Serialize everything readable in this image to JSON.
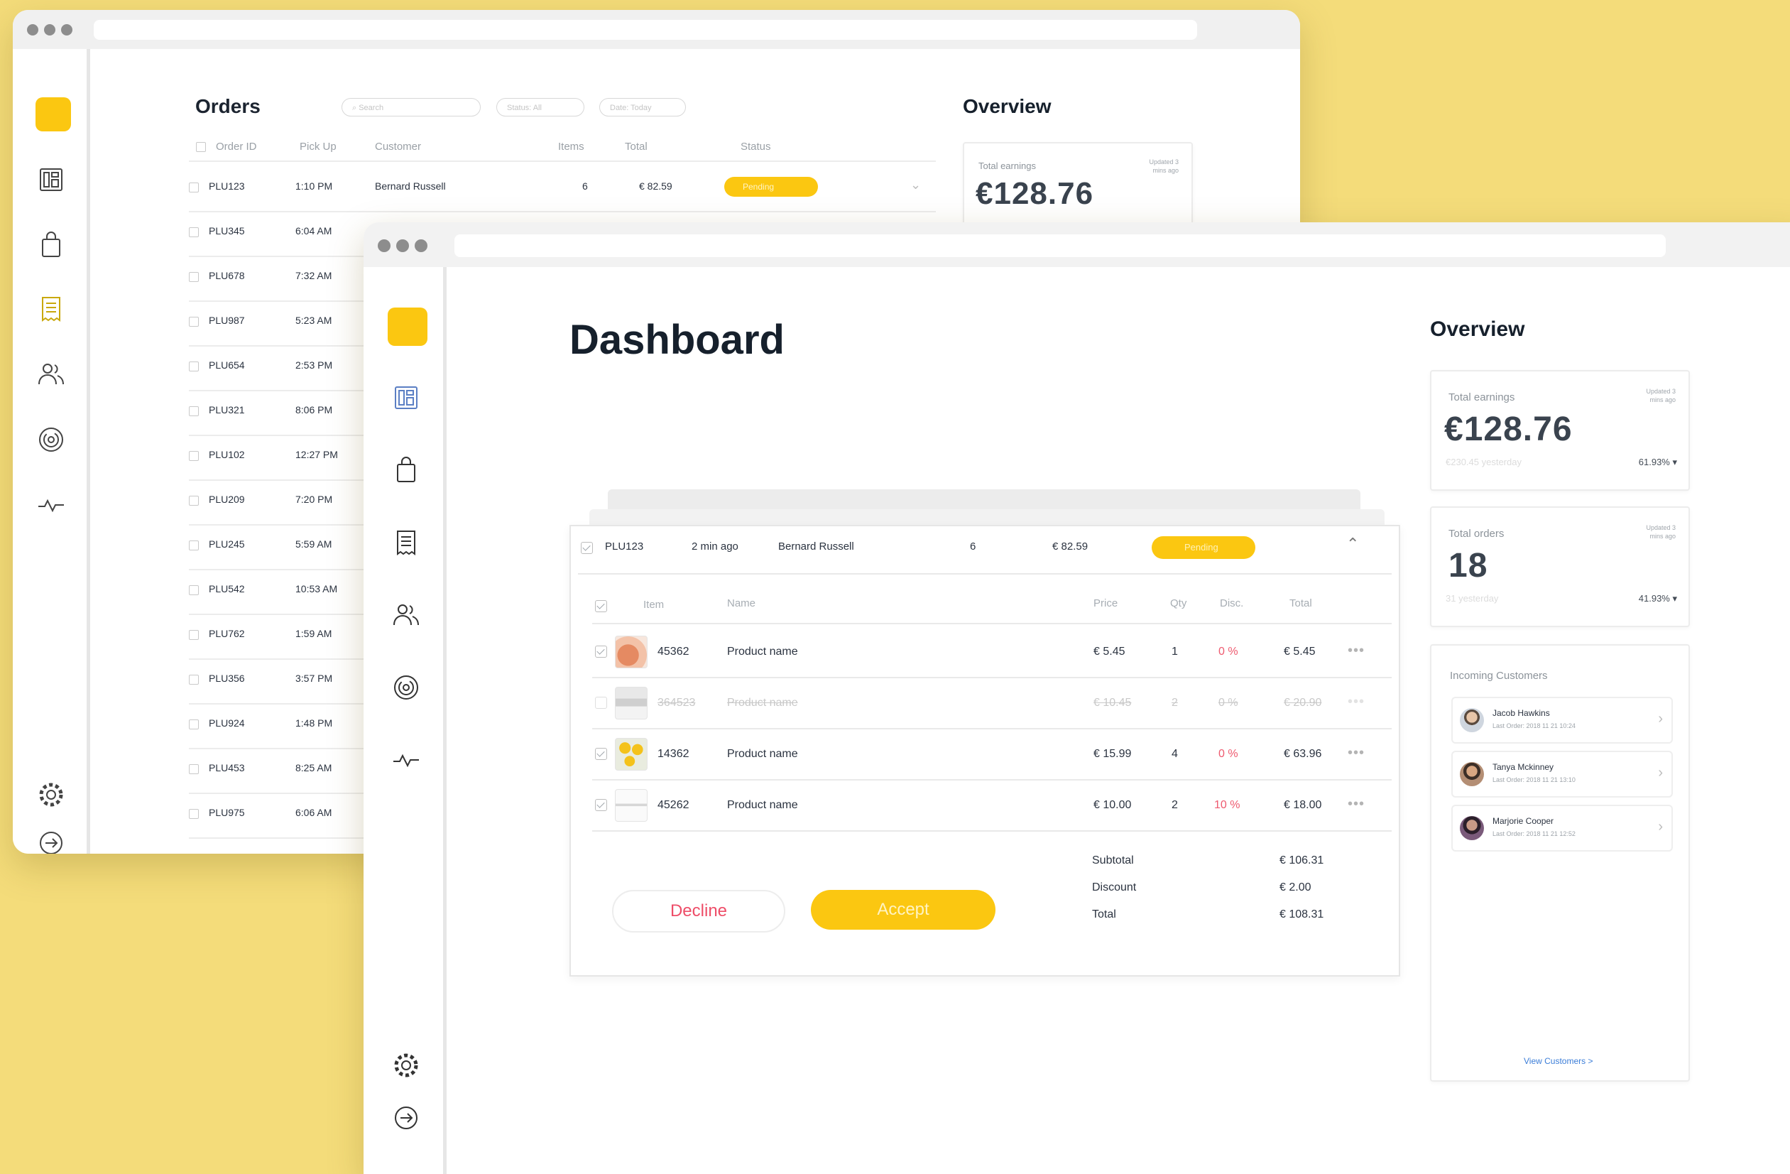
{
  "colors": {
    "accent": "#fbc711",
    "background": "#f4dc7a",
    "discount": "#ee5a6f",
    "decline": "#ee4d68"
  },
  "nav_icons": [
    "dashboard-icon",
    "shopping-bag-icon",
    "receipt-icon",
    "users-icon",
    "fingerprint-icon",
    "activity-icon",
    "settings-icon",
    "logout-icon"
  ],
  "back_window": {
    "title": "Orders",
    "search_placeholder": "Search",
    "status_filter": "Status: All",
    "date_filter": "Date: Today",
    "columns": [
      "Order ID",
      "Pick Up",
      "Customer",
      "Items",
      "Total",
      "Status"
    ],
    "first_order": {
      "id": "PLU123",
      "pickup": "1:10 PM",
      "customer": "Bernard Russell",
      "items": "6",
      "total": "€ 82.59",
      "status": "Pending"
    },
    "orders": [
      {
        "id": "PLU345",
        "pickup": "6:04 AM"
      },
      {
        "id": "PLU678",
        "pickup": "7:32 AM"
      },
      {
        "id": "PLU987",
        "pickup": "5:23 AM"
      },
      {
        "id": "PLU654",
        "pickup": "2:53 PM"
      },
      {
        "id": "PLU321",
        "pickup": "8:06 PM"
      },
      {
        "id": "PLU102",
        "pickup": "12:27 PM"
      },
      {
        "id": "PLU209",
        "pickup": "7:20 PM"
      },
      {
        "id": "PLU245",
        "pickup": "5:59 AM"
      },
      {
        "id": "PLU542",
        "pickup": "10:53 AM"
      },
      {
        "id": "PLU762",
        "pickup": "1:59 AM"
      },
      {
        "id": "PLU356",
        "pickup": "3:57 PM"
      },
      {
        "id": "PLU924",
        "pickup": "1:48 PM"
      },
      {
        "id": "PLU453",
        "pickup": "8:25 AM"
      },
      {
        "id": "PLU975",
        "pickup": "6:06 AM"
      }
    ],
    "overview_title": "Overview",
    "earnings_label": "Total earnings",
    "earnings_updated": "Updated 3 mins ago",
    "earnings_value": "€128.76"
  },
  "dashboard": {
    "title": "Dashboard",
    "order": {
      "id": "PLU123",
      "time": "2 min ago",
      "customer": "Bernard Russell",
      "items": "6",
      "total": "€ 82.59",
      "status": "Pending",
      "columns": {
        "item": "Item",
        "name": "Name",
        "price": "Price",
        "qty": "Qty",
        "disc": "Disc.",
        "total": "Total"
      },
      "lines": [
        {
          "item": "45362",
          "name": "Product name",
          "price": "€ 5.45",
          "qty": "1",
          "disc": "0 %",
          "total": "€ 5.45",
          "more": "•••",
          "checked": true
        },
        {
          "item": "364523",
          "name": "Product name",
          "price": "€ 10.45",
          "qty": "2",
          "disc": "0 %",
          "total": "€ 20.90",
          "more": "•••",
          "checked": false
        },
        {
          "item": "14362",
          "name": "Product name",
          "price": "€ 15.99",
          "qty": "4",
          "disc": "0 %",
          "total": "€ 63.96",
          "more": "•••",
          "checked": true
        },
        {
          "item": "45262",
          "name": "Product name",
          "price": "€ 10.00",
          "qty": "2",
          "disc": "10 %",
          "total": "€ 18.00",
          "more": "•••",
          "checked": true
        }
      ],
      "summary": [
        {
          "label": "Subtotal",
          "value": "€ 106.31"
        },
        {
          "label": "Discount",
          "value": "€ 2.00"
        },
        {
          "label": "Total",
          "value": "€ 108.31"
        }
      ],
      "decline_label": "Decline",
      "accept_label": "Accept"
    },
    "overview": {
      "title": "Overview",
      "earnings": {
        "label": "Total earnings",
        "updated": "Updated 3 mins ago",
        "value": "€128.76",
        "yesterday": "€230.45 yesterday",
        "pct": "61.93% ▾"
      },
      "orders": {
        "label": "Total orders",
        "updated": "Updated 3 mins ago",
        "value": "18",
        "yesterday": "31 yesterday",
        "pct": "41.93% ▾"
      },
      "customers_title": "Incoming Customers",
      "customers": [
        {
          "name": "Jacob Hawkins",
          "last": "Last Order: 2018 11 21 10:24"
        },
        {
          "name": "Tanya Mckinney",
          "last": "Last Order: 2018 11 21 13:10"
        },
        {
          "name": "Marjorie Cooper",
          "last": "Last Order: 2018 11 21 12:52"
        }
      ],
      "view_link": "View Customers >"
    }
  }
}
